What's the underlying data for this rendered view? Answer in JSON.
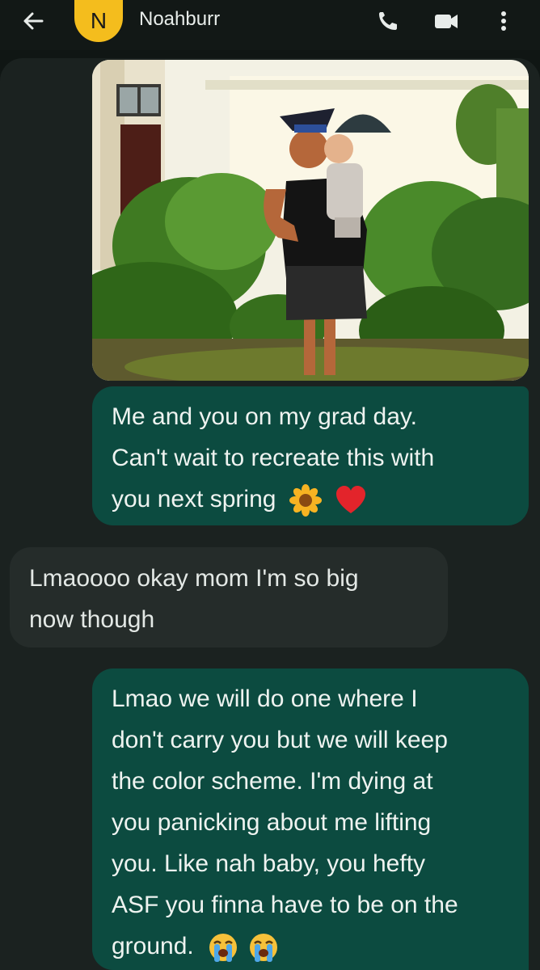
{
  "header": {
    "back_icon": "arrow-left-icon",
    "avatar_letter": "N",
    "avatar_color": "#f4bd1d",
    "contact_name": "Noahburr",
    "call_icon": "phone-icon",
    "video_icon": "video-camera-icon",
    "menu_icon": "more-vertical-icon"
  },
  "messages": [
    {
      "direction": "outgoing",
      "type": "image",
      "image_description": "Graduate in cap and black dress holding a toddler in front of a house with hedges"
    },
    {
      "direction": "outgoing",
      "lines": [
        "Me and you on my grad day.",
        "Can't wait to recreate this with",
        "you next spring"
      ],
      "emojis": [
        "sunflower",
        "red-heart"
      ]
    },
    {
      "direction": "incoming",
      "lines": [
        "Lmaoooo okay mom I'm so big",
        "now though"
      ]
    },
    {
      "direction": "outgoing",
      "lines": [
        "Lmao we will do one where I",
        "don't carry you but we will keep",
        "the color scheme. I'm dying at",
        "you panicking about me lifting",
        "you. Like nah baby, you hefty",
        "ASF you finna have to be on the",
        "ground."
      ],
      "emojis": [
        "loudly-crying-face",
        "loudly-crying-face"
      ]
    }
  ],
  "colors": {
    "background": "#101614",
    "conversation_surface": "#1b2220",
    "outgoing_bubble": "#0c4b40",
    "incoming_bubble": "#252c2a",
    "text": "#eef3f0"
  }
}
